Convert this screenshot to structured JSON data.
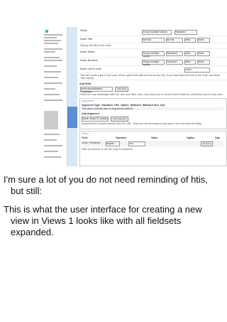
{
  "ui": {
    "rows": [
      {
        "text": "Sticky",
        "select": "Group multiple values",
        "extra": "Standard"
      },
      {
        "text": "Node: Title",
        "a": "Normal",
        "b": "As link",
        "c": "New",
        "d": "None"
      },
      {
        "text": "Display the title of the node."
      },
      {
        "text": "Node: Datum",
        "a": "Group multiple values",
        "b": "Standard",
        "c": "New",
        "d": "None"
      },
      {
        "text": "Node: Benutzer",
        "a": "Group multiple values",
        "b": "Trimmed",
        "c": "New",
        "d": "None"
      },
      {
        "text": "Node: Link to node",
        "e": "Label"
      },
      {
        "text": "This will create a link to the node; fill the option field with the text for the link. If you want titles that link to the node, use Node: Title instead."
      }
    ],
    "add_field": "Add Field",
    "field_select": "Internationalization: Language",
    "add_field_button": "Add Field",
    "help1": "Fields are only meaningful with List view and Table View; they allow you to choose which fields are presented and in what order.",
    "arguments_legend": "Arguments",
    "arguments_cols": [
      "Argument Type",
      "Standard",
      "Title",
      "Option",
      "Wildcard",
      "Wildcard Sub",
      "Ops"
    ],
    "no_arguments": "This view currently has no arguments defined.",
    "add_argument": "Add Argument",
    "argument_select": "Node: Node ID (Node)",
    "add_argument_button": "Add Argument",
    "help2": "Arguments are parsed directly from the URL. They are not necessary to any given view, but allow flexibility.",
    "filters_legend": "Filters",
    "filters_cols": [
      "Field",
      "Operator",
      "Value",
      "Option",
      "Ops"
    ],
    "filter_row": {
      "field": "Node: Published",
      "op": "Equals",
      "value": "Yes",
      "option": "",
      "ops": "Remove"
    },
    "filter_help": "Filter by whether or not the node is published."
  },
  "caption": {
    "p1": "I'm sure a lot of you do not need reminding of htis, but still:",
    "p2": "This is what the user interface for creating a new view in Views 1 looks like with all fieldsets expanded."
  }
}
